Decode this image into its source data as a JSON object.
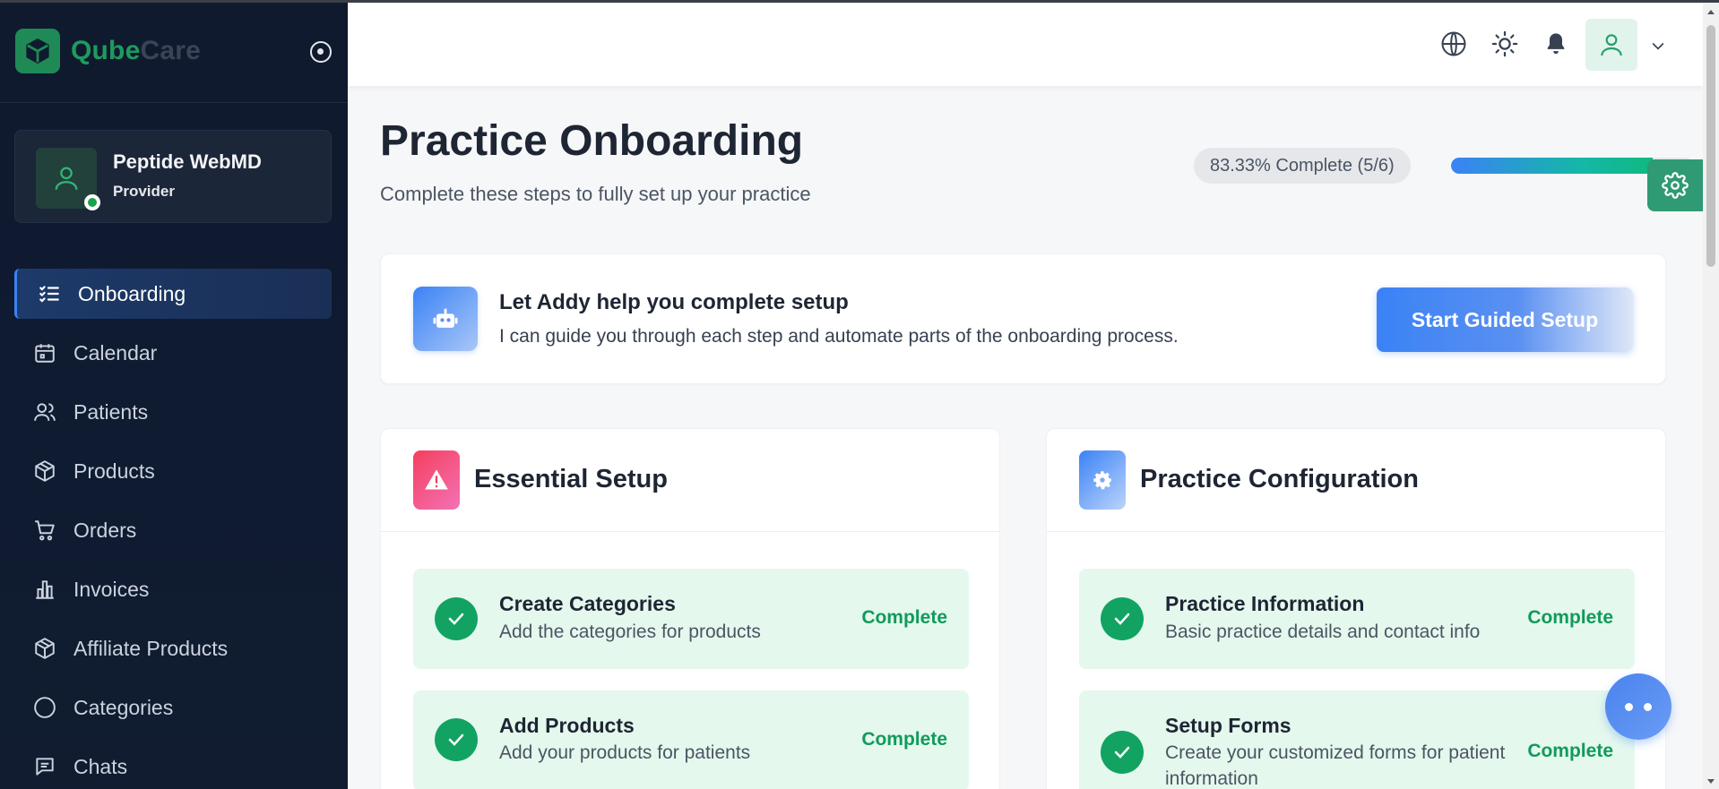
{
  "brand": {
    "name_part1": "Qube",
    "name_part2": "Care"
  },
  "user": {
    "name": "Peptide WebMD",
    "role": "Provider"
  },
  "sidebar": {
    "items": [
      {
        "label": "Onboarding",
        "icon": "list-check-icon",
        "active": true
      },
      {
        "label": "Calendar",
        "icon": "calendar-icon"
      },
      {
        "label": "Patients",
        "icon": "users-icon"
      },
      {
        "label": "Products",
        "icon": "box-icon"
      },
      {
        "label": "Orders",
        "icon": "cart-icon"
      },
      {
        "label": "Invoices",
        "icon": "bar-chart-icon"
      },
      {
        "label": "Affiliate Products",
        "icon": "box-icon"
      },
      {
        "label": "Categories",
        "icon": "circle-icon"
      },
      {
        "label": "Chats",
        "icon": "chat-icon"
      }
    ]
  },
  "header": {
    "title": "Practice Onboarding",
    "subtitle": "Complete these steps to fully set up your practice",
    "progress_label": "83.33% Complete (5/6)",
    "progress_fraction": 0.8333
  },
  "addy": {
    "title": "Let Addy help you complete setup",
    "description": "I can guide you through each step and automate parts of the onboarding process.",
    "button_label": "Start Guided Setup"
  },
  "essential": {
    "title": "Essential Setup",
    "tasks": [
      {
        "title": "Create Categories",
        "description": "Add the categories for products",
        "status": "Complete"
      },
      {
        "title": "Add Products",
        "description": "Add your products for patients",
        "status": "Complete"
      }
    ]
  },
  "practice": {
    "title": "Practice Configuration",
    "tasks": [
      {
        "title": "Practice Information",
        "description": "Basic practice details and contact info",
        "status": "Complete"
      },
      {
        "title": "Setup Forms",
        "description": "Create your customized forms for patient information",
        "status": "Complete"
      }
    ]
  },
  "colors": {
    "accent": "#3b82f6",
    "success": "#12a362",
    "brand": "#1f8a55",
    "sidebar_bg": "#0f1a2e"
  }
}
